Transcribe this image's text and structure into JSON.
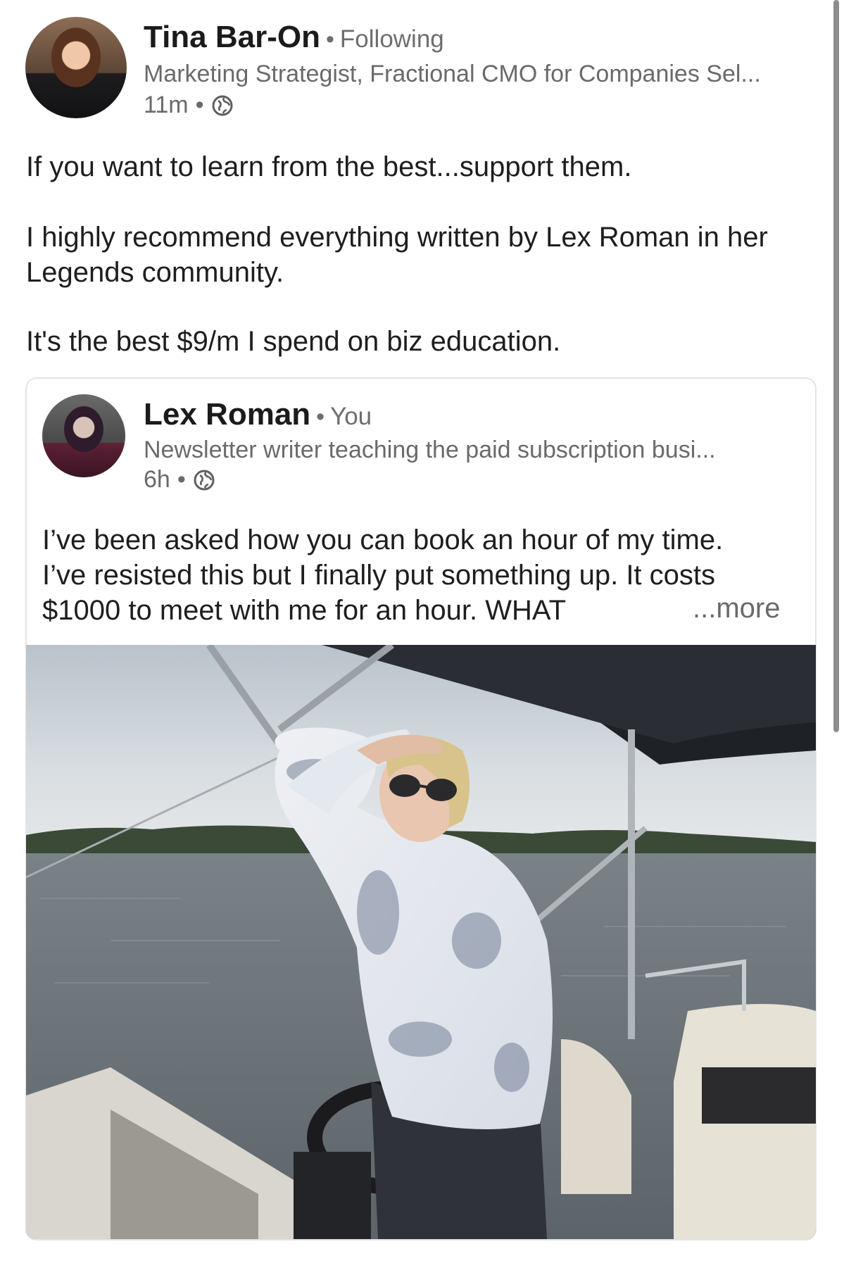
{
  "outer_post": {
    "author_name": "Tina Bar-On",
    "dot": "•",
    "relationship": "Following",
    "headline": "Marketing Strategist, Fractional CMO for Companies Sel...",
    "time": "11m",
    "visibility_icon": "globe-icon",
    "body": {
      "p1": "If you want to learn from the best...support them.",
      "p2": " I highly recommend everything written by Lex Roman in her Legends community.",
      "p3": "It's the best $9/m I spend on biz education."
    }
  },
  "shared_post": {
    "author_name": "Lex Roman",
    "dot": "•",
    "relationship": "You",
    "headline": "Newsletter writer teaching the paid subscription busi...",
    "time": "6h",
    "visibility_icon": "globe-icon",
    "body_lines": [
      "I’ve been asked how you can book an hour of my time.",
      "I’ve resisted this but I finally put something up. It costs",
      "$1000 to meet with me for an hour. WHAT"
    ],
    "more_label": "...more",
    "photo_icon": "boat-photo"
  },
  "colors": {
    "text": "#1e1e1e",
    "secondary": "#6a6a6a",
    "card_border": "#e4e4e4"
  }
}
